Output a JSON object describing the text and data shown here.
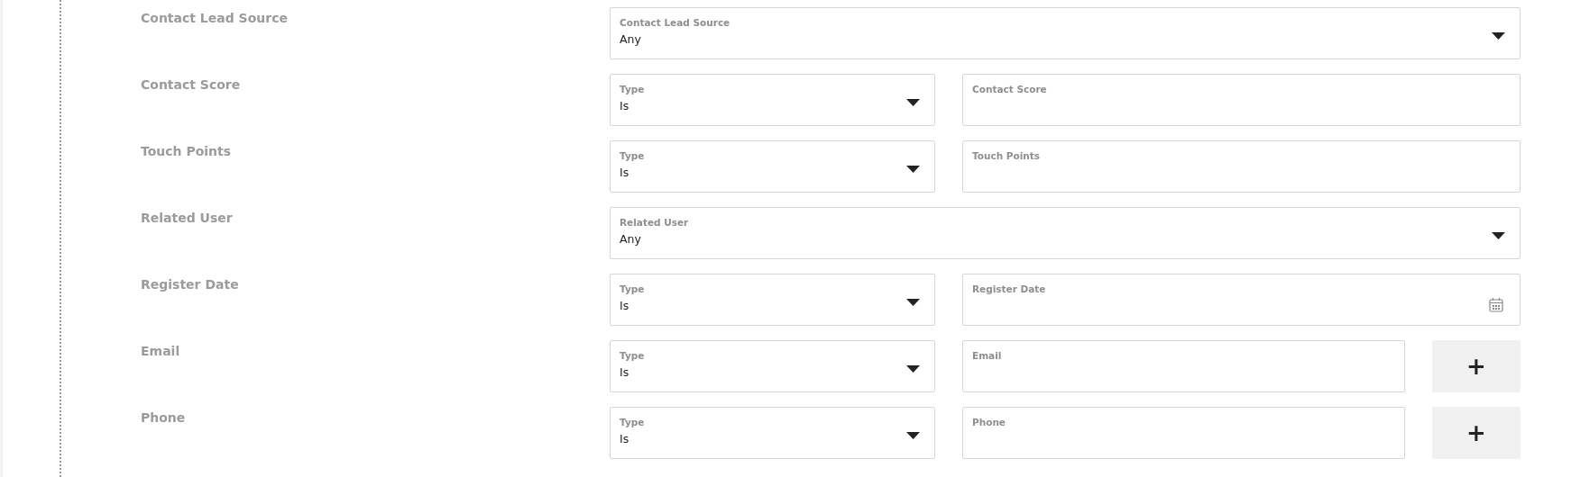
{
  "rows": [
    {
      "label": "Contact Lead Source",
      "kind": "select",
      "select": {
        "label": "Contact Lead Source",
        "value": "Any"
      }
    },
    {
      "label": "Contact Score",
      "kind": "pair",
      "select": {
        "label": "Type",
        "value": "Is"
      },
      "input": {
        "label": "Contact Score",
        "kind": "text"
      }
    },
    {
      "label": "Touch Points",
      "kind": "pair",
      "select": {
        "label": "Type",
        "value": "Is"
      },
      "input": {
        "label": "Touch Points",
        "kind": "text"
      }
    },
    {
      "label": "Related User",
      "kind": "select",
      "select": {
        "label": "Related User",
        "value": "Any"
      }
    },
    {
      "label": "Register Date",
      "kind": "pair",
      "select": {
        "label": "Type",
        "value": "Is"
      },
      "input": {
        "label": "Register Date",
        "kind": "date"
      }
    },
    {
      "label": "Email",
      "kind": "pair",
      "select": {
        "label": "Type",
        "value": "Is"
      },
      "input": {
        "label": "Email",
        "kind": "text"
      },
      "add_button": "+"
    },
    {
      "label": "Phone",
      "kind": "pair",
      "select": {
        "label": "Type",
        "value": "Is"
      },
      "input": {
        "label": "Phone",
        "kind": "text"
      },
      "add_button": "+"
    }
  ]
}
